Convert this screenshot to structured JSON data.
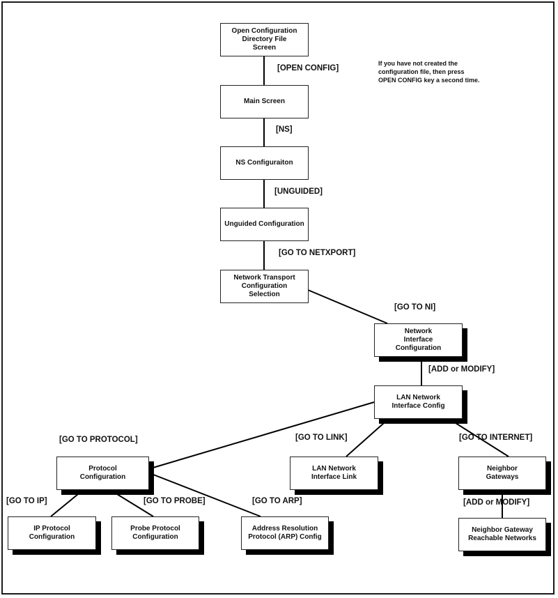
{
  "diagram": {
    "note": "If you have not created the\nconfiguration file, then press\nOPEN CONFIG key a second time.",
    "nodes": {
      "open_config_dir": "Open Configuration\nDirectory File\nScreen",
      "main_screen": "Main Screen",
      "ns_config": "NS Configuraiton",
      "unguided_config": "Unguided Configuration",
      "net_transport": "Network Transport\nConfiguration\nSelection",
      "net_interface": "Network\nInterface\nConfiguration",
      "lan_ni_config": "LAN Network\nInterface Config",
      "protocol_config": "Protocol\nConfiguration",
      "lan_ni_link": "LAN Network\nInterface Link",
      "neighbor_gateways": "Neighbor\nGateways",
      "ip_protocol": "IP Protocol\nConfiguration",
      "probe_protocol": "Probe Protocol\nConfiguration",
      "arp_config": "Address Resolution\nProtocol (ARP) Config",
      "neighbor_reachable": "Neighbor Gateway\nReachable Networks"
    },
    "edges": {
      "open_config": "[OPEN CONFIG]",
      "ns": "[NS]",
      "unguided": "[UNGUIDED]",
      "go_to_netxport": "[GO TO NETXPORT]",
      "go_to_ni": "[GO TO NI]",
      "add_or_modify_1": "[ADD or MODIFY]",
      "go_to_protocol": "[GO TO PROTOCOL]",
      "go_to_link": "[GO TO LINK]",
      "go_to_internet": "[GO TO INTERNET]",
      "go_to_ip": "[GO TO IP]",
      "go_to_probe": "[GO TO PROBE]",
      "go_to_arp": "[GO TO ARP]",
      "add_or_modify_2": "[ADD or MODIFY]"
    }
  }
}
